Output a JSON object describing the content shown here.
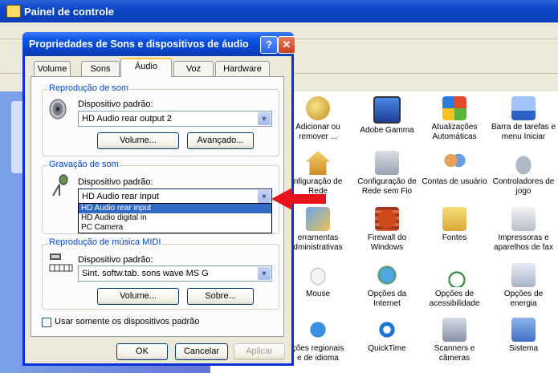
{
  "control_panel": {
    "title": "Painel de controle",
    "items": [
      {
        "label": "Adicionar ou\nremover ...",
        "icon": "add-remove-programs-icon"
      },
      {
        "label": "Adobe Gamma",
        "icon": "monitor-icon"
      },
      {
        "label": "Atualizações\nAutomáticas",
        "icon": "windows-update-icon"
      },
      {
        "label": "Barra de tarefas e\nmenu Iniciar",
        "icon": "taskbar-icon"
      },
      {
        "label": "nfiguração de\nRede",
        "icon": "network-setup-icon"
      },
      {
        "label": "Configuração de\nRede sem Fio",
        "icon": "wireless-icon"
      },
      {
        "label": "Contas de usuário",
        "icon": "users-icon"
      },
      {
        "label": "Controladores de\njogo",
        "icon": "game-controller-icon"
      },
      {
        "label": "erramentas\ndministrativas",
        "icon": "admin-tools-icon"
      },
      {
        "label": "Firewall do\nWindows",
        "icon": "firewall-icon"
      },
      {
        "label": "Fontes",
        "icon": "fonts-folder-icon"
      },
      {
        "label": "Impressoras e\naparelhos de fax",
        "icon": "printer-icon"
      },
      {
        "label": "Mouse",
        "icon": "mouse-icon"
      },
      {
        "label": "Opções da\nInternet",
        "icon": "internet-options-icon"
      },
      {
        "label": "Opções de\nacessibilidade",
        "icon": "accessibility-icon"
      },
      {
        "label": "Opções de energia",
        "icon": "power-icon"
      },
      {
        "label": "ções regionais\ne de idioma",
        "icon": "globe-icon"
      },
      {
        "label": "QuickTime",
        "icon": "quicktime-icon"
      },
      {
        "label": "Scanners e\ncâmeras",
        "icon": "scanner-icon"
      },
      {
        "label": "Sistema",
        "icon": "system-icon"
      }
    ]
  },
  "dialog": {
    "title": "Propriedades de Sons e dispositivos de áudio",
    "help": "?",
    "close": "✕",
    "tabs": [
      "Volume",
      "Sons",
      "Áudio",
      "Voz",
      "Hardware"
    ],
    "active_tab": "Áudio",
    "playback": {
      "group_title": "Reprodução de som",
      "device_label": "Dispositivo padrão:",
      "device_value": "HD Audio rear output 2",
      "volume_button": "Volume...",
      "advanced_button": "Avançado..."
    },
    "recording": {
      "group_title": "Gravação de som",
      "device_label": "Dispositivo padrão:",
      "device_value": "HD Audio rear input",
      "options": [
        "HD Audio rear input",
        "HD Audio digital in",
        "PC Camera"
      ],
      "selected_option": "HD Audio rear input"
    },
    "midi": {
      "group_title": "Reprodução de música MIDI",
      "device_label": "Dispositivo padrão:",
      "device_value": "Sint. softw.tab. sons wave MS G",
      "volume_button": "Volume...",
      "about_button": "Sobre..."
    },
    "checkbox_label": "Usar somente os dispositivos padrão",
    "ok": "OK",
    "cancel": "Cancelar",
    "apply": "Aplicar"
  },
  "colors": {
    "accent": "#0831d9",
    "arrow": "#e8141d",
    "selection": "#316ac5"
  }
}
